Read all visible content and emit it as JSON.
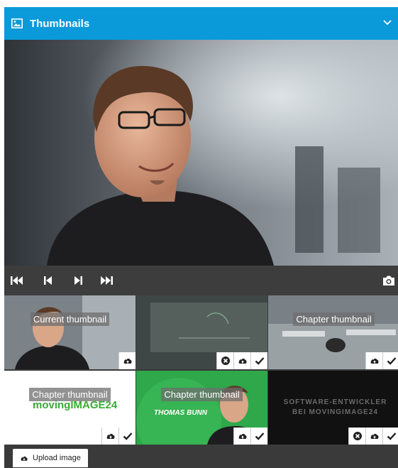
{
  "panel": {
    "title": "Thumbnails",
    "title_icon": "image-icon",
    "collapse_icon": "chevron-down-icon",
    "accent_color": "#0a9ad9"
  },
  "toolbar": {
    "buttons": [
      "skip-to-start-icon",
      "step-back-icon",
      "step-forward-icon",
      "skip-to-end-icon"
    ],
    "capture_icon": "camera-icon"
  },
  "thumbnails": [
    {
      "label": "Current thumbnail",
      "actions": [
        "cloud-upload-icon"
      ]
    },
    {
      "label": "",
      "actions": [
        "remove-icon",
        "cloud-upload-icon",
        "check-icon"
      ]
    },
    {
      "label": "Chapter thumbnail",
      "actions": [
        "cloud-upload-icon",
        "check-icon"
      ]
    },
    {
      "label": "Chapter thumbnail",
      "image_text": "movingIMAGE24",
      "actions": [
        "cloud-upload-icon",
        "check-icon"
      ]
    },
    {
      "label": "Chapter thumbnail",
      "image_text": "THOMAS BUNN",
      "actions": [
        "cloud-upload-icon",
        "check-icon"
      ]
    },
    {
      "label": "",
      "image_text": "SOFTWARE-ENTWICKLER BEI MOVINGIMAGE24",
      "actions": [
        "remove-icon",
        "cloud-upload-icon",
        "check-icon"
      ]
    }
  ],
  "footer": {
    "upload_label": "Upload image",
    "upload_icon": "cloud-upload-icon"
  }
}
